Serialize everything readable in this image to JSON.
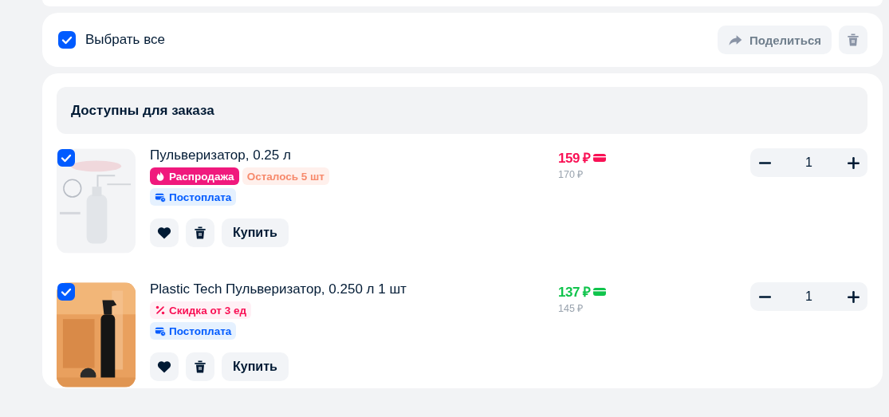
{
  "select_all": {
    "label": "Выбрать все",
    "checked": true
  },
  "toolbar": {
    "share_label": "Поделиться"
  },
  "section": {
    "title": "Доступны для заказа"
  },
  "items": [
    {
      "checked": true,
      "title": "Пульверизатор, 0.25 л",
      "tags": [
        [
          {
            "kind": "sale",
            "label": "Распродажа"
          },
          {
            "kind": "stock",
            "label": "Осталось 5 шт"
          }
        ],
        [
          {
            "kind": "postpay",
            "label": "Постоплата"
          }
        ]
      ],
      "price": {
        "value": "159 ₽",
        "color": "#f91155",
        "old": "170 ₽"
      },
      "quantity": "1",
      "buy_label": "Купить"
    },
    {
      "checked": true,
      "title": "Plastic Tech Пульверизатор, 0.250 л 1 шт",
      "tags": [
        [
          {
            "kind": "discount",
            "label": "Скидка от 3 ед"
          }
        ],
        [
          {
            "kind": "postpay",
            "label": "Постоплата"
          }
        ]
      ],
      "price": {
        "value": "137 ₽",
        "color": "#10c44c",
        "old": "145 ₽"
      },
      "quantity": "1",
      "buy_label": "Купить"
    }
  ]
}
